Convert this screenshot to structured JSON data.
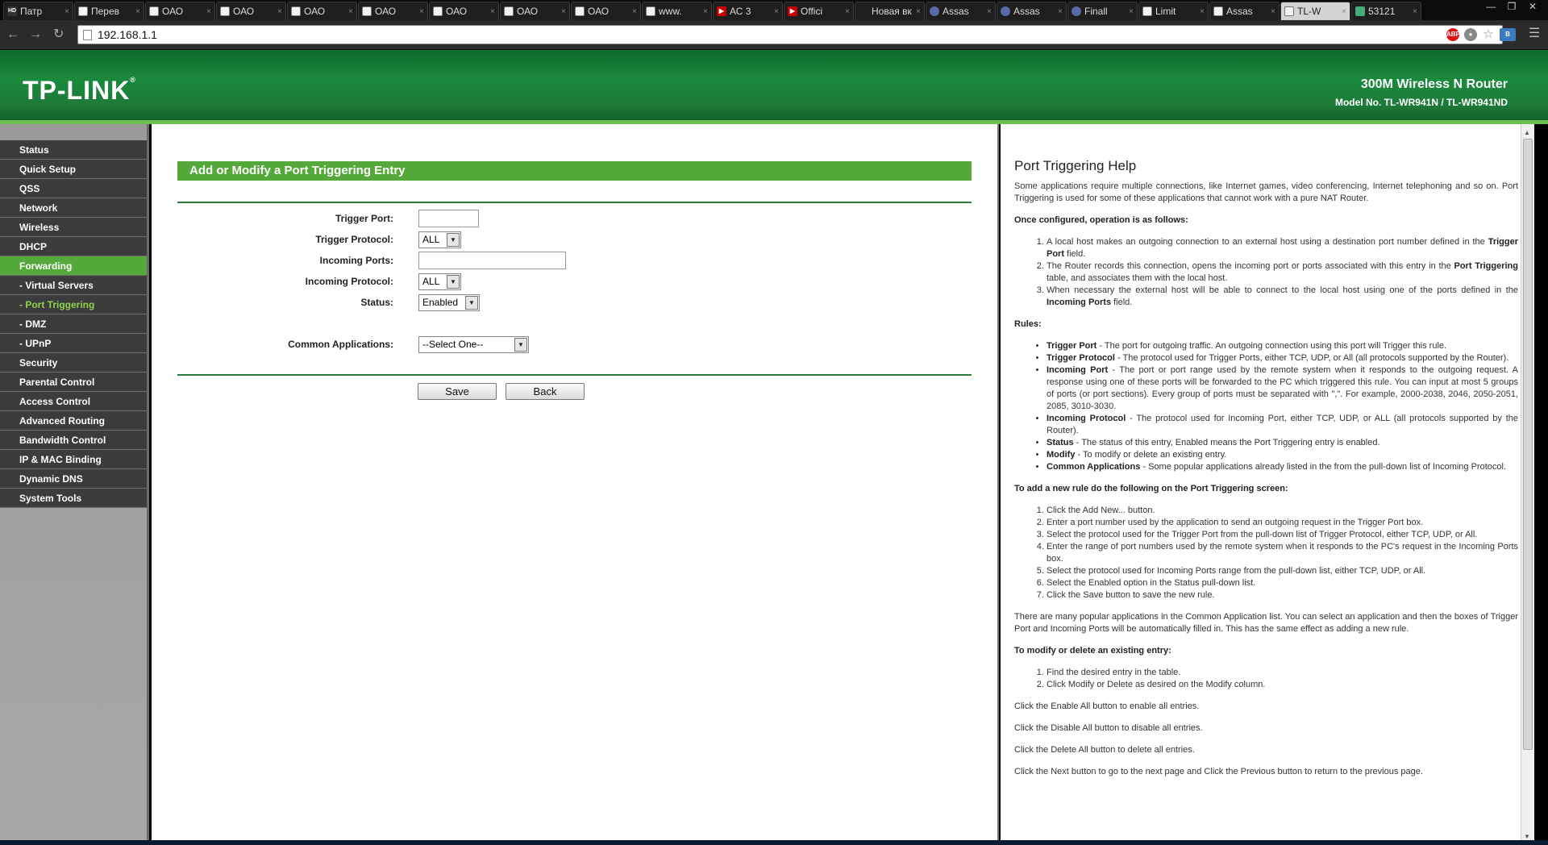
{
  "browser": {
    "tabs": [
      {
        "title": "Патр",
        "icon": "hd-icon"
      },
      {
        "title": "Перев",
        "icon": "translate-icon"
      },
      {
        "title": "ОАО",
        "icon": "page-icon"
      },
      {
        "title": "ОАО",
        "icon": "page-icon"
      },
      {
        "title": "ОАО",
        "icon": "page-icon"
      },
      {
        "title": "ОАО",
        "icon": "page-icon"
      },
      {
        "title": "ОАО",
        "icon": "page-icon"
      },
      {
        "title": "ОАО",
        "icon": "page-icon"
      },
      {
        "title": "ОАО",
        "icon": "page-icon"
      },
      {
        "title": "www.",
        "icon": "page-icon"
      },
      {
        "title": "АС 3",
        "icon": "youtube-icon"
      },
      {
        "title": "Offici",
        "icon": "youtube-icon"
      },
      {
        "title": "Новая вк",
        "icon": "blank-icon"
      },
      {
        "title": "Assas",
        "icon": "globe-icon"
      },
      {
        "title": "Assas",
        "icon": "globe-icon"
      },
      {
        "title": "Finall",
        "icon": "globe-icon"
      },
      {
        "title": "Limit",
        "icon": "page-icon"
      },
      {
        "title": "Assas",
        "icon": "page-icon"
      },
      {
        "title": "TL-W",
        "icon": "page-icon",
        "active": true
      },
      {
        "title": "53121",
        "icon": "image-icon"
      }
    ],
    "url": "192.168.1.1",
    "window_controls": [
      "—",
      "❐",
      "✕"
    ]
  },
  "header": {
    "logo": "TP-LINK",
    "product": "300M Wireless N Router",
    "model": "Model No. TL-WR941N / TL-WR941ND"
  },
  "menu": [
    {
      "label": "Status"
    },
    {
      "label": "Quick Setup"
    },
    {
      "label": "QSS"
    },
    {
      "label": "Network"
    },
    {
      "label": "Wireless"
    },
    {
      "label": "DHCP"
    },
    {
      "label": "Forwarding",
      "active": true
    },
    {
      "label": "- Virtual Servers",
      "sub": true
    },
    {
      "label": "- Port Triggering",
      "sub": true,
      "subactive": true
    },
    {
      "label": "- DMZ",
      "sub": true
    },
    {
      "label": "- UPnP",
      "sub": true
    },
    {
      "label": "Security"
    },
    {
      "label": "Parental Control"
    },
    {
      "label": "Access Control"
    },
    {
      "label": "Advanced Routing"
    },
    {
      "label": "Bandwidth Control"
    },
    {
      "label": "IP & MAC Binding"
    },
    {
      "label": "Dynamic DNS"
    },
    {
      "label": "System Tools"
    }
  ],
  "form": {
    "title": "Add or Modify a Port Triggering Entry",
    "trigger_port_label": "Trigger Port:",
    "trigger_port_value": "",
    "trigger_protocol_label": "Trigger Protocol:",
    "trigger_protocol_value": "ALL",
    "incoming_ports_label": "Incoming Ports:",
    "incoming_ports_value": "",
    "incoming_protocol_label": "Incoming Protocol:",
    "incoming_protocol_value": "ALL",
    "status_label": "Status:",
    "status_value": "Enabled",
    "common_apps_label": "Common Applications:",
    "common_apps_value": "--Select One--",
    "save_label": "Save",
    "back_label": "Back"
  },
  "help": {
    "title": "Port Triggering Help",
    "intro": "Some applications require multiple connections, like Internet games, video conferencing, Internet telephoning and so on. Port Triggering is used for some of these applications that cannot work with a pure NAT Router.",
    "op_heading": "Once configured, operation is as follows:",
    "op_items": [
      [
        "A local host makes an outgoing connection to an external host using a destination port number defined in the ",
        "Trigger Port",
        " field."
      ],
      [
        "The Router records this connection, opens the incoming port or ports associated with this entry in the ",
        "Port Triggering",
        " table, and associates them with the local host."
      ],
      [
        "When necessary the external host will be able to connect to the local host using one of the ports defined in the ",
        "Incoming Ports",
        " field."
      ]
    ],
    "rules_heading": "Rules:",
    "rules": [
      {
        "term": "Trigger Port",
        "text": " - The port for outgoing traffic. An outgoing connection using this port will Trigger this rule."
      },
      {
        "term": "Trigger Protocol",
        "text": " - The protocol used for Trigger Ports, either TCP, UDP, or All (all protocols supported by the Router)."
      },
      {
        "term": "Incoming Port",
        "text": " - The port or port range used by the remote system when it responds to the outgoing request. A response using one of these ports will be forwarded to the PC which triggered this rule. You can input at most 5 groups of ports (or port sections). Every group of ports must be separated with \",\". For example, 2000-2038, 2046, 2050-2051, 2085, 3010-3030."
      },
      {
        "term": "Incoming Protocol",
        "text": " - The protocol used for Incoming Port, either TCP, UDP, or ALL (all protocols supported by the Router)."
      },
      {
        "term": "Status",
        "text": " - The status of this entry, Enabled means the Port Triggering entry is enabled."
      },
      {
        "term": "Modify",
        "text": " - To modify or delete an existing entry."
      },
      {
        "term": "Common Applications",
        "text": " - Some popular applications already listed in the from the pull-down list of Incoming Protocol."
      }
    ],
    "add_heading": "To add a new rule do the following on the Port Triggering screen:",
    "add_steps": [
      "Click the Add New... button.",
      "Enter a port number used by the application to send an outgoing request in the Trigger Port box.",
      "Select the protocol used for the Trigger Port from the pull-down list of Trigger Protocol, either TCP, UDP, or All.",
      "Enter the range of port numbers used by the remote system when it responds to the PC's request in the Incoming Ports box.",
      "Select the protocol used for Incoming Ports range from the pull-down list, either TCP, UDP, or All.",
      "Select the Enabled option in the Status pull-down list.",
      "Click the Save button to save the new rule."
    ],
    "popular": "There are many popular applications in the Common Application list. You can select an application and then the boxes of Trigger Port and Incoming Ports will be automatically filled in. This has the same effect as adding a new rule.",
    "modify_heading": "To modify or delete an existing entry:",
    "modify_steps": [
      "Find the desired entry in the table.",
      "Click Modify or Delete as desired on the Modify column."
    ],
    "enable_all": "Click the Enable All button to enable all entries.",
    "disable_all": "Click the Disable All button to disable all entries.",
    "delete_all": "Click the Delete All button to delete all entries.",
    "next_prev": "Click the Next button to go to the next page and Click the Previous button to return to the previous page."
  }
}
